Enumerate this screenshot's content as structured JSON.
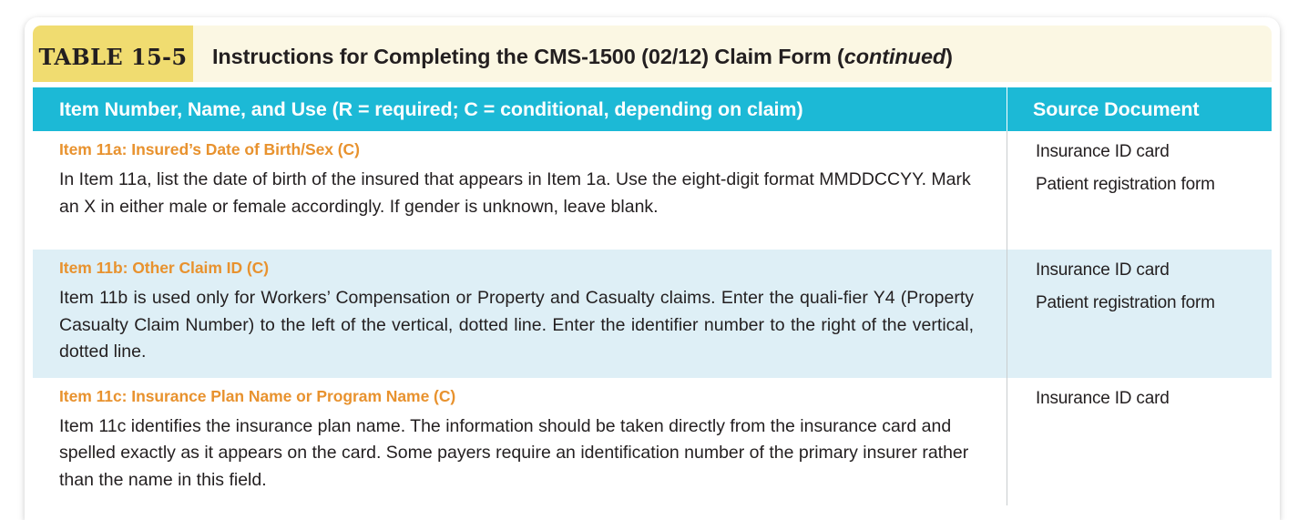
{
  "colors": {
    "tag_yellow": "#F0DC70",
    "title_cream": "#FBF7E3",
    "header_teal": "#1CB9D6",
    "heading_orange": "#E8922E",
    "shaded_row_blue": "#DEEFF6",
    "body_text": "#231F20",
    "divider_gray": "#C9CDCF"
  },
  "title_bar": {
    "tag": "TABLE 15-5",
    "title_main": "Instructions for Completing the CMS-1500 (02/12) Claim Form (",
    "title_continued": "continued",
    "title_close": ")"
  },
  "column_headers": {
    "left": "Item Number, Name, and Use (R = required; C = conditional, depending on claim)",
    "right": "Source Document"
  },
  "rows": [
    {
      "shaded": false,
      "heading": "Item 11a: Insured’s Date of Birth/Sex (C)",
      "body": "In Item 11a, list the date of birth of the insured that appears in Item 1a. Use the eight-digit format MMDDCCYY. Mark an X in either male or female accordingly. If gender is unknown, leave blank.",
      "sources": [
        "Insurance ID card",
        "Patient registration form"
      ]
    },
    {
      "shaded": true,
      "heading": "Item 11b: Other Claim ID (C)",
      "body": "Item 11b is used only for Workers’ Compensation or Property and Casualty claims. Enter the quali-fier Y4 (Property Casualty Claim Number) to the left of the vertical, dotted line. Enter the identifier number to the right of the vertical, dotted line.",
      "sources": [
        "Insurance ID card",
        "Patient registration form"
      ]
    },
    {
      "shaded": false,
      "heading": "Item 11c: Insurance Plan Name or Program Name (C)",
      "body": "Item 11c identifies the insurance plan name. The information should be taken directly from the insurance card and spelled exactly as it appears on the card. Some payers require an identification number of the primary insurer rather than the name in this field.",
      "sources": [
        "Insurance ID card"
      ]
    }
  ]
}
